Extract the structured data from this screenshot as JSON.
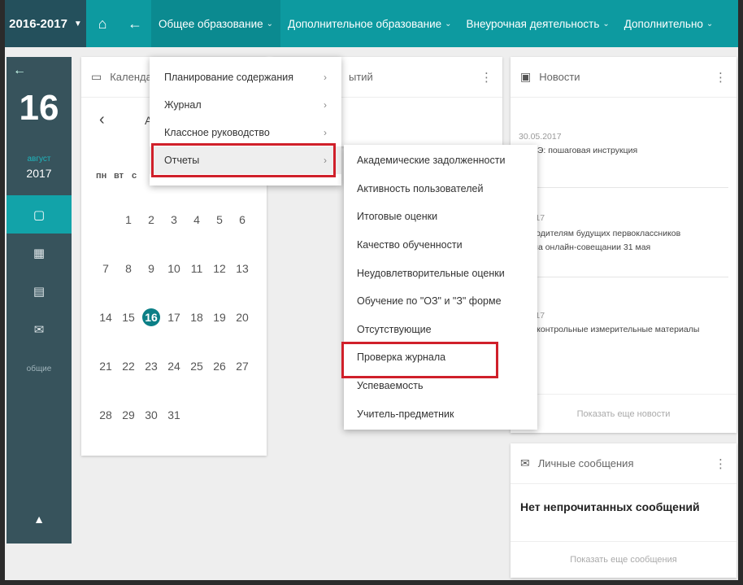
{
  "topbar": {
    "year": "2016-2017",
    "menu": [
      {
        "label": "Общее образование",
        "active": true
      },
      {
        "label": "Дополнительное образование",
        "active": false
      },
      {
        "label": "Внеурочная деятельность",
        "active": false
      },
      {
        "label": "Дополнительно",
        "active": false
      }
    ]
  },
  "sidebar": {
    "day": "16",
    "month": "август",
    "year": "2017",
    "label": "общие"
  },
  "calendar": {
    "title": "Календарь",
    "month_partial": "А",
    "weekdays": [
      "пн",
      "вт",
      "с"
    ],
    "rows": [
      [
        "",
        "1",
        "2",
        "3",
        "4",
        "5",
        "6"
      ],
      [
        "7",
        "8",
        "9",
        "10",
        "11",
        "12",
        "13"
      ],
      [
        "14",
        "15",
        "16",
        "17",
        "18",
        "19",
        "20"
      ],
      [
        "21",
        "22",
        "23",
        "24",
        "25",
        "26",
        "27"
      ],
      [
        "28",
        "29",
        "30",
        "31",
        "",
        "",
        ""
      ]
    ],
    "today": "16"
  },
  "events": {
    "title_partial": "ытий"
  },
  "news": {
    "title": "Новости",
    "items": [
      {
        "date": "30.05.2017",
        "text": "м ЕГЭ: пошаговая инструкция"
      },
      {
        "date": "5.2017",
        "text": "ты родителям будущих первоклассников\nзат на онлайн-совещании 31 мая"
      },
      {
        "date": "5.2017",
        "text": "ки и контрольные измерительные материалы"
      }
    ],
    "more": "Показать еще новости"
  },
  "messages": {
    "title": "Личные сообщения",
    "empty": "Нет непрочитанных сообщений",
    "more": "Показать еще сообщения"
  },
  "dropdown1": {
    "items": [
      {
        "label": "Планирование содержания",
        "arrow": "›"
      },
      {
        "label": "Журнал",
        "arrow": "›"
      },
      {
        "label": "Классное руководство",
        "arrow": "›"
      },
      {
        "label": "Отчеты",
        "arrow": "›",
        "selected": true
      }
    ]
  },
  "dropdown2": {
    "items": [
      "Академические задолженности",
      "Активность пользователей",
      "Итоговые оценки",
      "Качество обученности",
      "Неудовлетворительные оценки",
      "Обучение по \"ОЗ\" и \"З\" форме",
      "Отсутствующие",
      "Проверка журнала",
      "Успеваемость",
      "Учитель-предметник"
    ],
    "highlighted": "Проверка журнала"
  },
  "colors": {
    "topbar": "#0d9aa0",
    "sidebar": "#37535c",
    "highlight": "#d0202a"
  }
}
